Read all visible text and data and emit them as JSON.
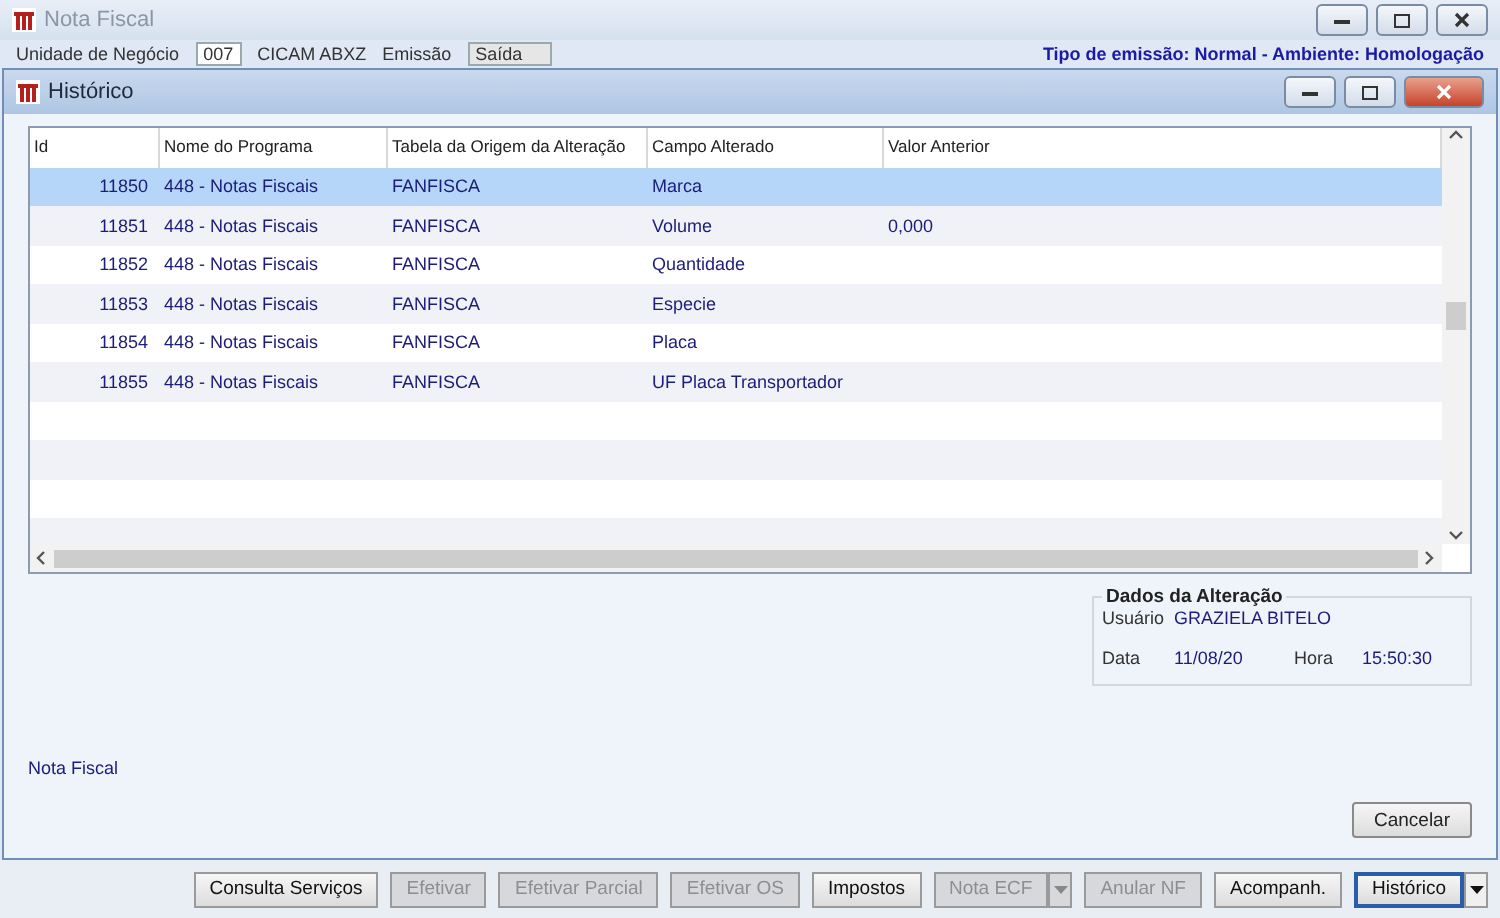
{
  "window": {
    "title": "Nota Fiscal"
  },
  "header_fields": [
    {
      "kind": "label",
      "text": "Unidade de Negócio"
    },
    {
      "kind": "field",
      "text": "007"
    },
    {
      "kind": "label",
      "text": "CICAM ABXZ"
    },
    {
      "kind": "label",
      "text": "Emissão"
    },
    {
      "kind": "select",
      "text": "Saída"
    },
    {
      "kind": "info",
      "text": "Tipo de emissão: Normal - Ambiente: Homologação"
    }
  ],
  "dialog": {
    "title": "Histórico",
    "table": {
      "columns": [
        "Id",
        "Nome do Programa",
        "Tabela da Origem da Alteração",
        "Campo Alterado",
        "Valor Anterior"
      ],
      "rows": [
        {
          "selected": true,
          "cells": [
            "11850",
            "448 - Notas Fiscais",
            "FANFISCA",
            "Marca",
            ""
          ]
        },
        {
          "selected": false,
          "cells": [
            "11851",
            "448 - Notas Fiscais",
            "FANFISCA",
            "Volume",
            "0,000"
          ]
        },
        {
          "selected": false,
          "cells": [
            "11852",
            "448 - Notas Fiscais",
            "FANFISCA",
            "Quantidade",
            ""
          ]
        },
        {
          "selected": false,
          "cells": [
            "11853",
            "448 - Notas Fiscais",
            "FANFISCA",
            "Especie",
            ""
          ]
        },
        {
          "selected": false,
          "cells": [
            "11854",
            "448 - Notas Fiscais",
            "FANFISCA",
            "Placa",
            ""
          ]
        },
        {
          "selected": false,
          "cells": [
            "11855",
            "448 - Notas Fiscais",
            "FANFISCA",
            "UF Placa Transportador",
            ""
          ]
        }
      ]
    },
    "details": {
      "title": "Dados da Alteração",
      "user_label": "Usuário",
      "user": "GRAZIELA BITELO",
      "date_label": "Data",
      "date": "11/08/20",
      "time_label": "Hora",
      "time": "15:50:30"
    },
    "footer_label": "Nota Fiscal",
    "cancel_button": "Cancelar"
  },
  "toolbar": [
    {
      "label": "Consulta Serviços",
      "disabled": false,
      "dropdown": false,
      "focused": false
    },
    {
      "label": "Efetivar",
      "disabled": true,
      "dropdown": false,
      "focused": false
    },
    {
      "label": "Efetivar Parcial",
      "disabled": true,
      "dropdown": false,
      "focused": false
    },
    {
      "label": "Efetivar OS",
      "disabled": true,
      "dropdown": false,
      "focused": false
    },
    {
      "label": "Impostos",
      "disabled": false,
      "dropdown": false,
      "focused": false
    },
    {
      "label": "Nota ECF",
      "disabled": true,
      "dropdown": true,
      "focused": false
    },
    {
      "label": "Anular NF",
      "disabled": true,
      "dropdown": false,
      "focused": false
    },
    {
      "label": "Acompanh.",
      "disabled": false,
      "dropdown": false,
      "focused": false
    },
    {
      "label": "Histórico",
      "disabled": false,
      "dropdown": true,
      "focused": true
    }
  ]
}
